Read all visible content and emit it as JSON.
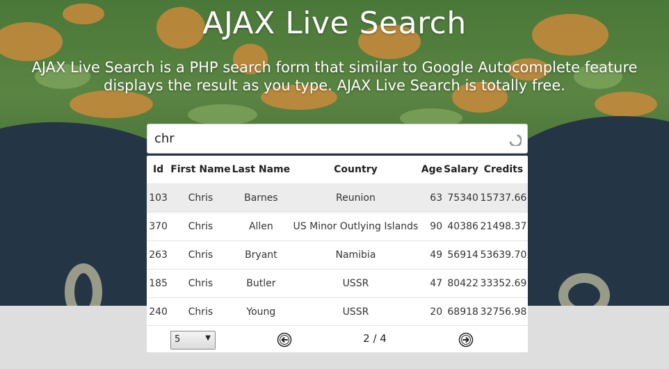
{
  "hero": {
    "title": "AJAX Live Search",
    "subtitle": "AJAX Live Search is a PHP search form that similar to Google Autocomplete feature displays the result as you type. AJAX Live Search is totally free."
  },
  "search": {
    "value": "chr",
    "loading_icon": "spinner-icon"
  },
  "table": {
    "headers": [
      "Id",
      "First Name",
      "Last Name",
      "Country",
      "Age",
      "Salary",
      "Credits"
    ],
    "rows": [
      [
        "103",
        "Chris",
        "Barnes",
        "Reunion",
        "63",
        "75340",
        "15737.66"
      ],
      [
        "370",
        "Chris",
        "Allen",
        "US Minor Outlying Islands",
        "90",
        "40386",
        "21498.37"
      ],
      [
        "263",
        "Chris",
        "Bryant",
        "Namibia",
        "49",
        "56914",
        "53639.70"
      ],
      [
        "185",
        "Chris",
        "Butler",
        "USSR",
        "47",
        "80422",
        "33352.69"
      ],
      [
        "240",
        "Chris",
        "Young",
        "USSR",
        "20",
        "68918",
        "32756.98"
      ]
    ]
  },
  "pagination": {
    "per_page": "5",
    "page_label": "2 / 4",
    "prev_icon": "arrow-left-circle-icon",
    "next_icon": "arrow-right-circle-icon"
  },
  "colors": {
    "hero_dark": "#243646",
    "hero_green": "#4f7d3c",
    "hero_orange": "#c98a3c",
    "highlight_row": "#ececec"
  }
}
